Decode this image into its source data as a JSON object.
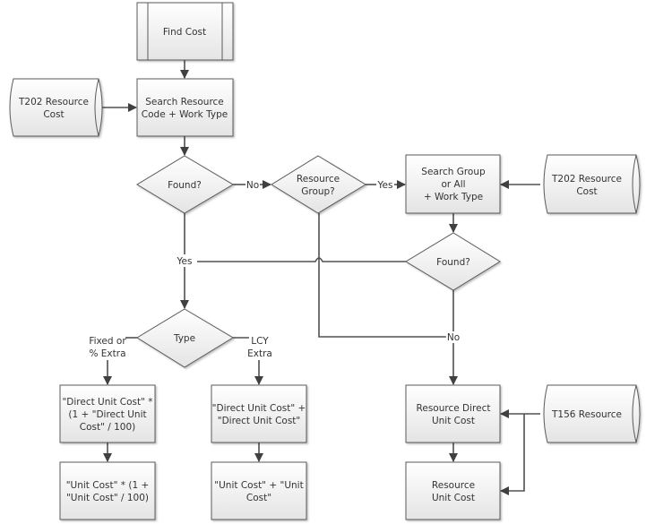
{
  "diagram": {
    "title": "Find Cost flowchart",
    "colors": {
      "stroke": "#5a5a5a",
      "fill_top": "#ffffff",
      "fill_bottom": "#e6e6e6",
      "connector": "#404040",
      "text": "#333333"
    },
    "nodes": {
      "find_cost": {
        "type": "predefined-process",
        "lines": [
          "Find Cost"
        ]
      },
      "t202_left": {
        "type": "database",
        "lines": [
          "T202 Resource",
          "Cost"
        ]
      },
      "search_resource": {
        "type": "process",
        "lines": [
          "Search Resource",
          "Code + Work Type"
        ]
      },
      "found1": {
        "type": "decision",
        "lines": [
          "Found?"
        ]
      },
      "resource_group": {
        "type": "decision",
        "lines": [
          "Resource",
          "Group?"
        ]
      },
      "search_group": {
        "type": "process",
        "lines": [
          "Search Group",
          "or All",
          "+ Work Type"
        ]
      },
      "t202_right": {
        "type": "database",
        "lines": [
          "T202 Resource",
          "Cost"
        ]
      },
      "found2": {
        "type": "decision",
        "lines": [
          "Found?"
        ]
      },
      "type": {
        "type": "decision",
        "lines": [
          "Type"
        ]
      },
      "direct_pct": {
        "type": "process",
        "lines": [
          "\"Direct Unit Cost\" *",
          "(1 + \"Direct Unit",
          "Cost\" / 100)"
        ]
      },
      "unit_pct": {
        "type": "process",
        "lines": [
          "\"Unit Cost\" * (1 +",
          "\"Unit Cost\" / 100)"
        ]
      },
      "direct_lcy": {
        "type": "process",
        "lines": [
          "\"Direct Unit Cost\" +",
          "\"Direct Unit Cost\""
        ]
      },
      "unit_lcy": {
        "type": "process",
        "lines": [
          "\"Unit Cost\" + \"Unit",
          "Cost\""
        ]
      },
      "res_direct": {
        "type": "process",
        "lines": [
          "Resource Direct",
          "Unit Cost"
        ]
      },
      "res_unit": {
        "type": "process",
        "lines": [
          "Resource",
          "Unit Cost"
        ]
      },
      "t156": {
        "type": "database",
        "lines": [
          "T156 Resource"
        ]
      }
    },
    "edge_labels": {
      "found1_no": "No",
      "group_yes": "Yes",
      "found_yes": "Yes",
      "fixed_pct": [
        "Fixed or",
        "% Extra"
      ],
      "lcy_extra": [
        "LCY",
        "Extra"
      ],
      "group_no": "No"
    }
  }
}
